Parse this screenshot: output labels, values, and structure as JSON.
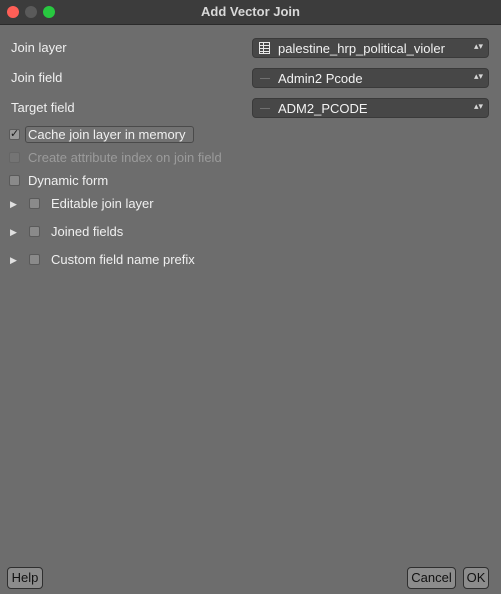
{
  "window": {
    "title": "Add Vector Join"
  },
  "form": {
    "join_layer": {
      "label": "Join layer",
      "value": "palestine_hrp_political_violer"
    },
    "join_field": {
      "label": "Join field",
      "value": "Admin2 Pcode"
    },
    "target_field": {
      "label": "Target field",
      "value": "ADM2_PCODE"
    }
  },
  "options": {
    "cache": {
      "label": "Cache join layer in memory",
      "checked": true
    },
    "index": {
      "label": "Create attribute index on join field",
      "checked": false,
      "enabled": false
    },
    "dynamic": {
      "label": "Dynamic form",
      "checked": false
    }
  },
  "groups": {
    "editable": {
      "label": "Editable join layer"
    },
    "joined": {
      "label": "Joined fields"
    },
    "prefix": {
      "label": "Custom field name prefix"
    }
  },
  "buttons": {
    "help": "Help",
    "cancel": "Cancel",
    "ok": "OK"
  },
  "icons": {
    "combo_arrow": "updown-arrow-icon",
    "expander": "triangle-right-icon"
  }
}
